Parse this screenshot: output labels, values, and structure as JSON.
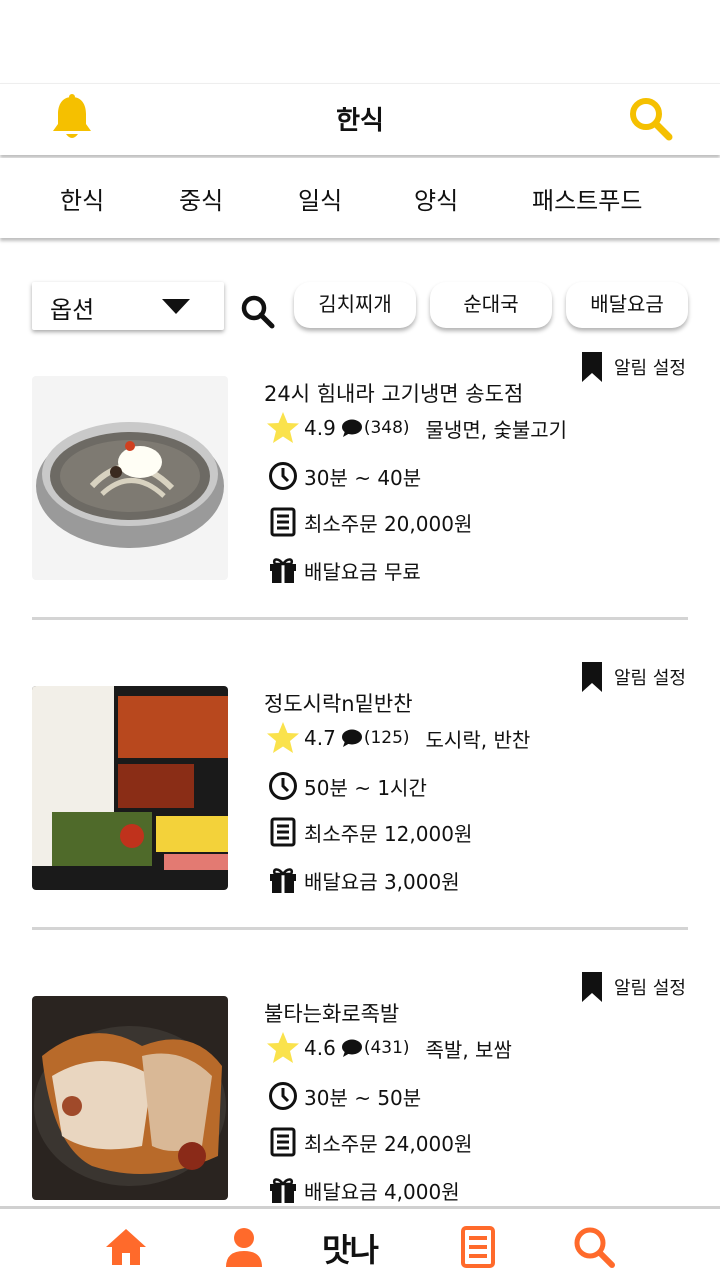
{
  "header": {
    "title": "한식",
    "bell_icon": "bell-icon",
    "search_icon": "search-icon",
    "accent": "#F5C000"
  },
  "categories": [
    "한식",
    "중식",
    "일식",
    "양식",
    "패스트푸드"
  ],
  "filter": {
    "option_label": "옵션",
    "chips": [
      "김치찌개",
      "순대국",
      "배달요금"
    ]
  },
  "restaurants": [
    {
      "name": "24시 힘내라 고기냉면 송도점",
      "rating": "4.9",
      "reviews": "(348)",
      "tags": "물냉면, 숯불고기",
      "time": "30분 ~ 40분",
      "min_order": "최소주문 20,000원",
      "delivery_fee": "배달요금 무료",
      "bookmark_label": "알림 설정",
      "photo": "cold noodles"
    },
    {
      "name": "정도시락n밑반찬",
      "rating": "4.7",
      "reviews": "(125)",
      "tags": "도시락, 반찬",
      "time": "50분 ~ 1시간",
      "min_order": "최소주문 12,000원",
      "delivery_fee": "배달요금 3,000원",
      "bookmark_label": "알림 설정",
      "photo": "lunch box"
    },
    {
      "name": "불타는화로족발",
      "rating": "4.6",
      "reviews": "(431)",
      "tags": "족발, 보쌈",
      "time": "30분 ~ 50분",
      "min_order": "최소주문 24,000원",
      "delivery_fee": "배달요금 4,000원",
      "bookmark_label": "알림 설정",
      "photo": "pork trotters"
    }
  ],
  "bottom_nav": {
    "logo": "맛나",
    "items": [
      "home-icon",
      "user-icon",
      "list-icon",
      "search-icon"
    ],
    "color": "#FF6A2B"
  }
}
